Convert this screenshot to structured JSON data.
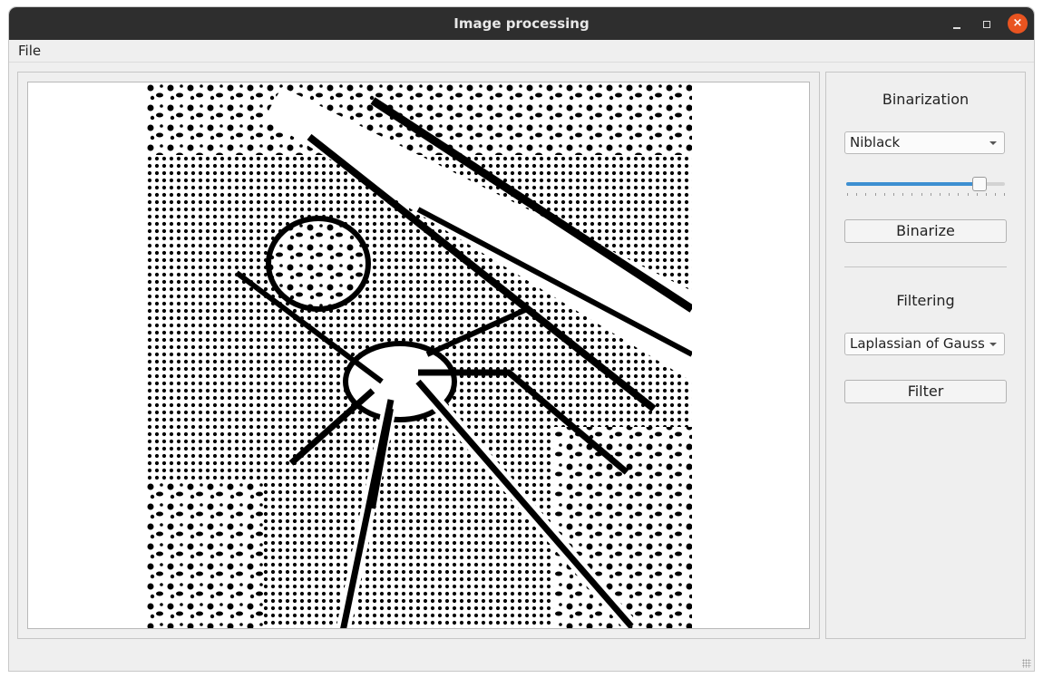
{
  "window": {
    "title": "Image processing",
    "controls": {
      "minimize_icon": "minimize-icon",
      "maximize_icon": "maximize-icon",
      "close_icon": "close-icon",
      "close_glyph": "×"
    }
  },
  "menu": {
    "items": [
      {
        "label": "File"
      }
    ]
  },
  "image_view": {
    "content": "binarized-spider-image"
  },
  "binarization": {
    "title": "Binarization",
    "method": "Niblack",
    "slider_level": 0.84,
    "button_label": "Binarize"
  },
  "filtering": {
    "title": "Filtering",
    "method": "Laplassian of Gauss",
    "button_label": "Filter"
  },
  "colors": {
    "titlebar": "#2e2e2e",
    "close_button": "#e95420",
    "slider_fill": "#3d8fd1",
    "window_bg": "#efefef"
  }
}
